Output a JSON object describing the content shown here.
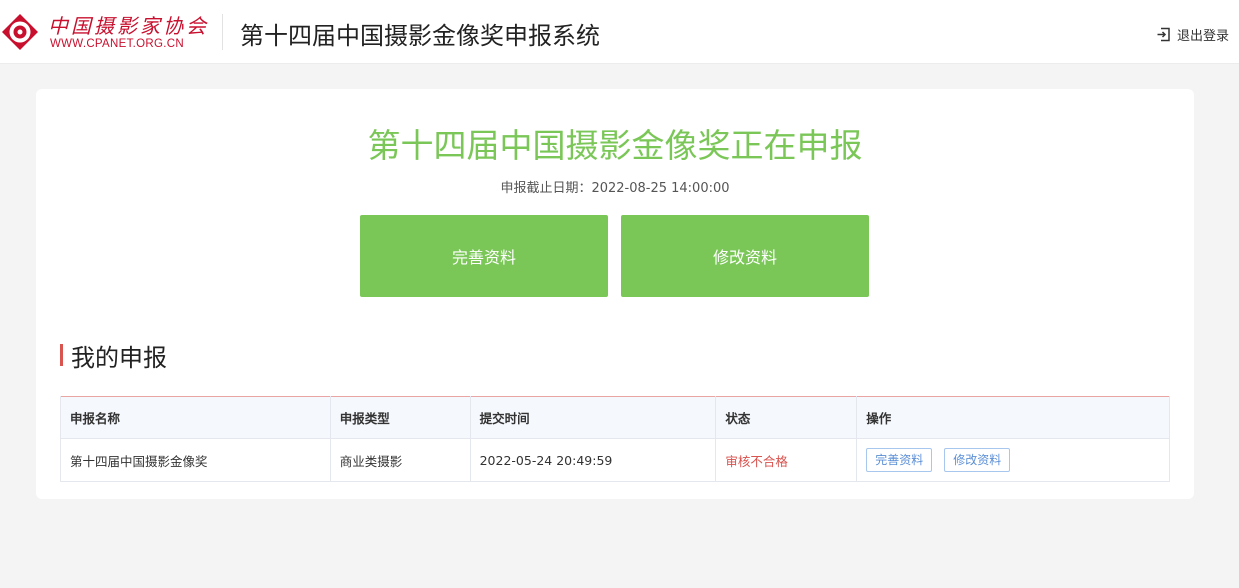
{
  "header": {
    "logo_cn": "中国摄影家协会",
    "logo_url": "WWW.CPANET.ORG.CN",
    "system_title": "第十四届中国摄影金像奖申报系统",
    "logout_label": "退出登录",
    "logout_icon": "logout-icon"
  },
  "hero": {
    "title": "第十四届中国摄影金像奖正在申报",
    "deadline": "申报截止日期：2022-08-25 14:00:00",
    "complete_button": "完善资料",
    "modify_button": "修改资料"
  },
  "section": {
    "title": "我的申报"
  },
  "table": {
    "headers": [
      "申报名称",
      "申报类型",
      "提交时间",
      "状态",
      "操作"
    ],
    "rows": [
      {
        "name": "第十四届中国摄影金像奖",
        "type": "商业类摄影",
        "submit_time": "2022-05-24 20:49:59",
        "status": "审核不合格",
        "actions": [
          "完善资料",
          "修改资料"
        ]
      }
    ]
  },
  "colors": {
    "accent_green": "#7ac757",
    "brand_red": "#c8102e",
    "status_red": "#d9534f",
    "link_blue": "#5b8fd6"
  }
}
